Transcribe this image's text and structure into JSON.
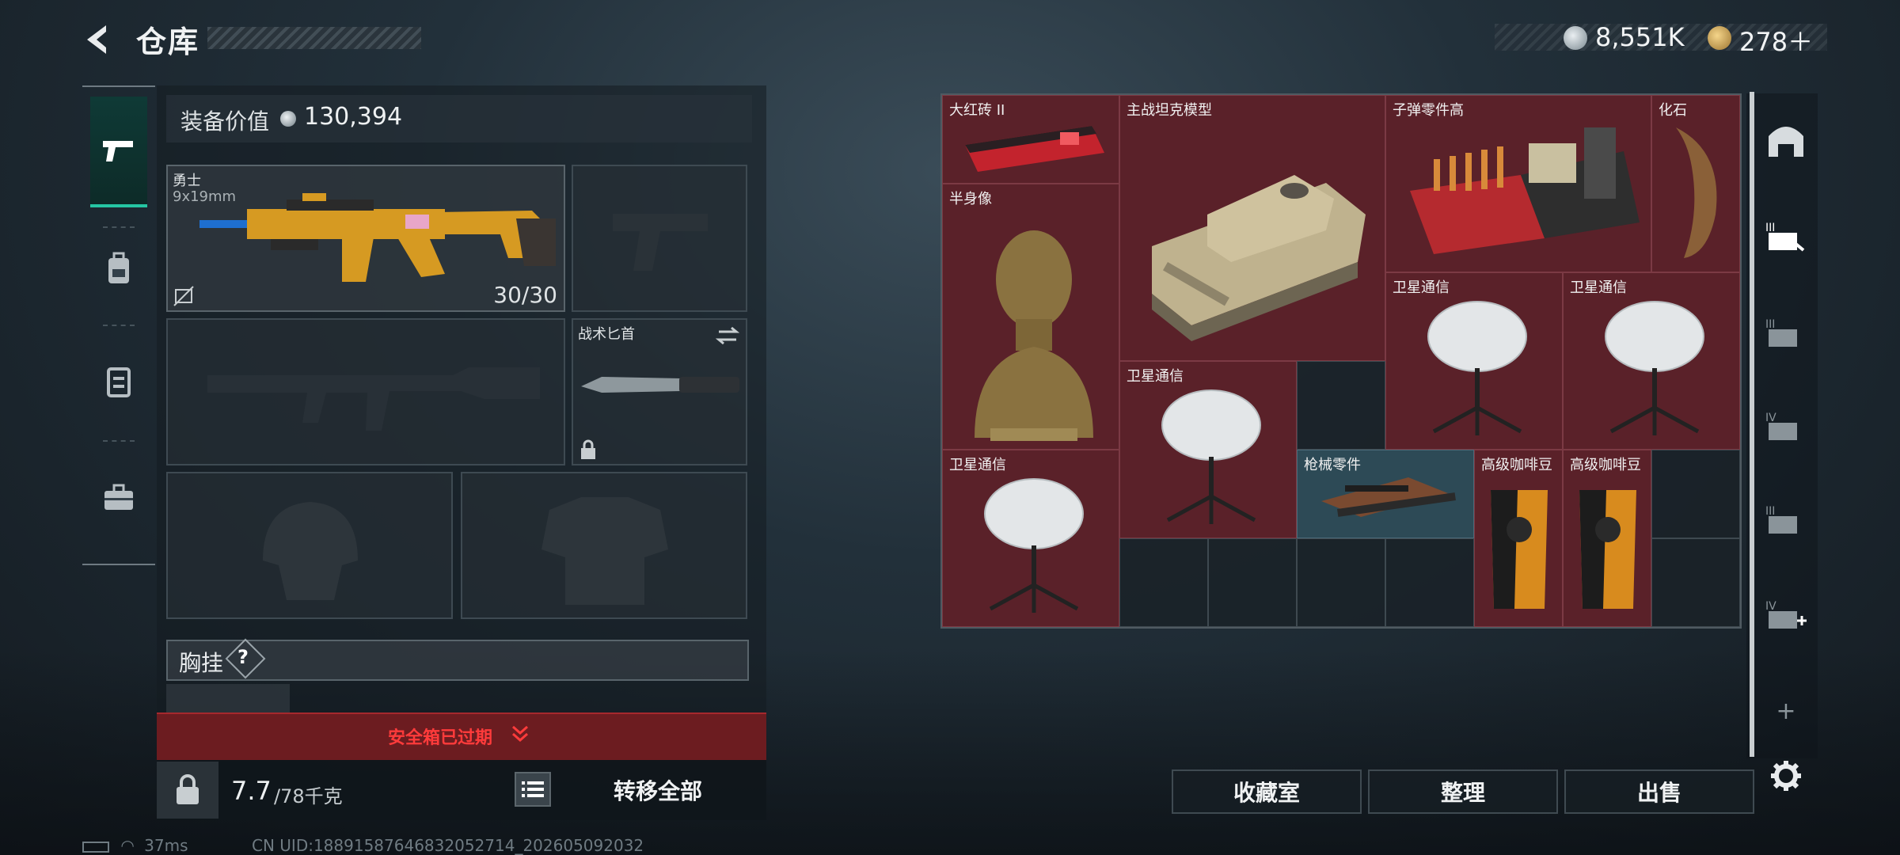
{
  "header": {
    "title": "仓库",
    "money": "8,551K",
    "tokens": "278＋"
  },
  "tabs": [
    {
      "name": "weapon-tab",
      "icon": "pistol-icon",
      "active": true
    },
    {
      "name": "backpack-tab",
      "icon": "backpack-icon",
      "active": false
    },
    {
      "name": "rig-tab",
      "icon": "rig-icon",
      "active": false
    },
    {
      "name": "case-tab",
      "icon": "briefcase-icon",
      "active": false
    }
  ],
  "loadout": {
    "value_label": "装备价值",
    "value": "130,394",
    "primary_weapon": {
      "name": "勇士",
      "caliber": "9x19mm",
      "ammo": "30/30"
    },
    "knife": {
      "name": "战术匕首"
    },
    "chest_label": "胸挂",
    "chest_help": "?",
    "safe_box_expired": "安全箱已过期",
    "weight_current": "7.7",
    "weight_max": "/78千克",
    "transfer_all": "转移全部"
  },
  "stash": {
    "items": [
      {
        "label": "大红砖 II",
        "icon": "red-brick-icon"
      },
      {
        "label": "主战坦克模型",
        "icon": "tank-model-icon"
      },
      {
        "label": "子弹零件高",
        "icon": "ammo-parts-icon"
      },
      {
        "label": "化石",
        "icon": "fossil-icon"
      },
      {
        "label": "半身像",
        "icon": "bust-icon"
      },
      {
        "label": "卫星通信",
        "icon": "satellite-dish-icon"
      },
      {
        "label": "卫星通信",
        "icon": "satellite-dish-icon"
      },
      {
        "label": "卫星通信",
        "icon": "satellite-dish-icon"
      },
      {
        "label": "卫星通信",
        "icon": "satellite-dish-icon"
      },
      {
        "label": "枪械零件",
        "icon": "gun-parts-icon"
      },
      {
        "label": "高级咖啡豆",
        "icon": "coffee-bag-icon"
      },
      {
        "label": "高级咖啡豆",
        "icon": "coffee-bag-icon"
      }
    ]
  },
  "side_nav": {
    "add": "+"
  },
  "actions": {
    "collection": "收藏室",
    "sort": "整理",
    "sell": "出售"
  },
  "status": {
    "ping": "37ms",
    "uid": "CN UID:18891587646832052714_202605092032"
  },
  "colors": {
    "accent": "#25c6a3",
    "item_red": "#5a2129",
    "item_blue": "#2d4a56",
    "warning": "#ff3b3b"
  }
}
